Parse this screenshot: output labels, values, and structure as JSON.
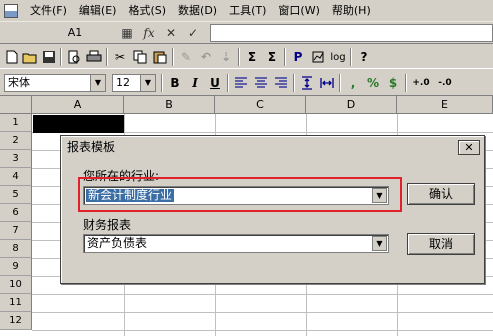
{
  "menubar": {
    "items": [
      "文件(F)",
      "编辑(E)",
      "格式(S)",
      "数据(D)",
      "工具(T)",
      "窗口(W)",
      "帮助(H)"
    ]
  },
  "formulabar": {
    "cell_ref": "A1",
    "fx": "fx",
    "cancel": "✕",
    "confirm": "✓"
  },
  "toolbar": {
    "sum_label": "Σ",
    "sum2_label": "Σ",
    "print_label": "P",
    "log_label": "log",
    "help_label": "?"
  },
  "format_toolbar": {
    "font": "宋体",
    "size": "12",
    "bold": "B",
    "italic": "I",
    "underline": "U",
    "comma": ",",
    "percent": "%",
    "currency": "$",
    "inc_decimal": "+.0",
    "dec_decimal": "-.0"
  },
  "sheet": {
    "columns": [
      "A",
      "B",
      "C",
      "D",
      "E"
    ],
    "rows": [
      "1",
      "2",
      "3",
      "4",
      "5",
      "6",
      "7",
      "8",
      "9",
      "10",
      "11",
      "12"
    ]
  },
  "dialog": {
    "title": "报表模板",
    "industry_label": "您所在的行业:",
    "industry_value": "新会计制度行业",
    "report_label": "财务报表",
    "report_value": "资产负债表",
    "ok_label": "确认",
    "cancel_label": "取消",
    "close_label": "✕"
  },
  "colors": {
    "highlight": "#e0202a",
    "selection": "#3a6ea5"
  }
}
